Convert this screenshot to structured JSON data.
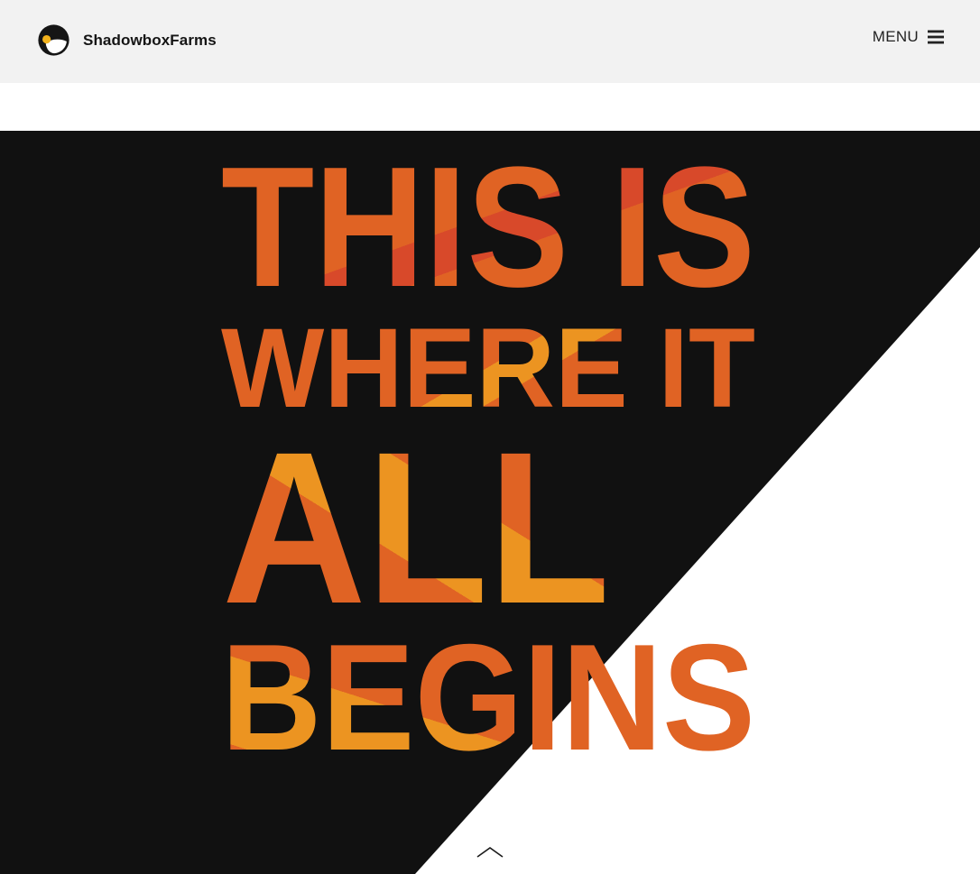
{
  "header": {
    "brand_name": "ShadowboxFarms",
    "logo_icon": "shadowbox-sun-logo-icon",
    "menu_label": "MENU",
    "menu_icon": "hamburger-icon"
  },
  "hero": {
    "line1": "THIS IS",
    "line2": "WHERE IT",
    "line3": "ALL",
    "line4": "BEGINS",
    "scroll_icon": "chevron-up-icon"
  },
  "colors": {
    "header_bg": "#f2f2f2",
    "hero_bg": "#111111",
    "page_bg": "#ffffff",
    "accent_orange": "#e06324",
    "accent_red": "#d8492a",
    "accent_amber": "#ec9421",
    "logo_yellow": "#f2b21c"
  }
}
